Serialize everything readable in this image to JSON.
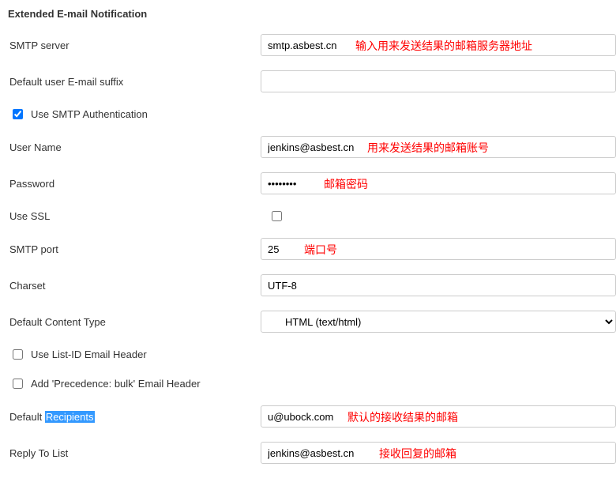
{
  "section": {
    "title": "Extended E-mail Notification"
  },
  "labels": {
    "smtp_server": "SMTP server",
    "default_suffix": "Default user E-mail suffix",
    "use_smtp_auth": "Use SMTP Authentication",
    "user_name": "User Name",
    "password": "Password",
    "use_ssl": "Use SSL",
    "smtp_port": "SMTP port",
    "charset": "Charset",
    "default_content_type": "Default Content Type",
    "use_listid": "Use List-ID Email Header",
    "add_precedence": "Add 'Precedence: bulk' Email Header",
    "default_recipients_prefix": "Default ",
    "default_recipients_highlight": "Recipients",
    "reply_to_list": "Reply To List"
  },
  "values": {
    "smtp_server": "smtp.asbest.cn",
    "default_suffix": "",
    "user_name": "jenkins@asbest.cn",
    "password": "••••••••",
    "smtp_port": "25",
    "charset": "UTF-8",
    "content_type": "HTML (text/html)",
    "default_recipients": "u@ubock.com",
    "reply_to_list": "jenkins@asbest.cn"
  },
  "annotations": {
    "smtp_server": "输入用来发送结果的邮箱服务器地址",
    "user_name": "用来发送结果的邮箱账号",
    "password": "邮箱密码",
    "smtp_port": "端口号",
    "default_recipients": "默认的接收结果的邮箱",
    "reply_to_list": "接收回复的邮箱"
  }
}
